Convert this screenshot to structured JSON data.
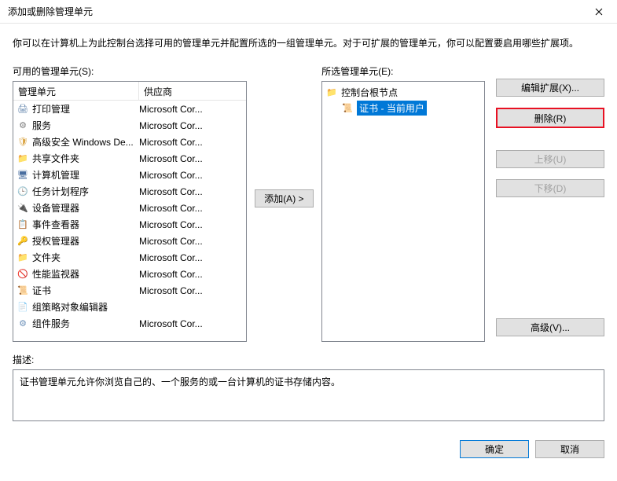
{
  "window": {
    "title": "添加或删除管理单元",
    "close_icon": "close-icon"
  },
  "intro": "你可以在计算机上为此控制台选择可用的管理单元并配置所选的一组管理单元。对于可扩展的管理单元，你可以配置要启用哪些扩展项。",
  "available": {
    "label": "可用的管理单元(S):",
    "columns": {
      "snapin": "管理单元",
      "vendor": "供应商"
    },
    "items": [
      {
        "icon": "printer-icon",
        "iconClass": "i-printer",
        "glyph": "🖨",
        "name": "打印管理",
        "vendor": "Microsoft Cor..."
      },
      {
        "icon": "gear-icon",
        "iconClass": "i-gear",
        "glyph": "⚙",
        "name": "服务",
        "vendor": "Microsoft Cor..."
      },
      {
        "icon": "shield-icon",
        "iconClass": "i-shield",
        "glyph": "🛡",
        "name": "高级安全 Windows De...",
        "vendor": "Microsoft Cor..."
      },
      {
        "icon": "share-icon",
        "iconClass": "i-share",
        "glyph": "📁",
        "name": "共享文件夹",
        "vendor": "Microsoft Cor..."
      },
      {
        "icon": "computer-icon",
        "iconClass": "i-comp",
        "glyph": "🖥",
        "name": "计算机管理",
        "vendor": "Microsoft Cor..."
      },
      {
        "icon": "clock-icon",
        "iconClass": "i-clock",
        "glyph": "🕒",
        "name": "任务计划程序",
        "vendor": "Microsoft Cor..."
      },
      {
        "icon": "device-icon",
        "iconClass": "i-dev",
        "glyph": "🔌",
        "name": "设备管理器",
        "vendor": "Microsoft Cor..."
      },
      {
        "icon": "event-icon",
        "iconClass": "i-event",
        "glyph": "📋",
        "name": "事件查看器",
        "vendor": "Microsoft Cor..."
      },
      {
        "icon": "auth-icon",
        "iconClass": "i-auth",
        "glyph": "🔑",
        "name": "授权管理器",
        "vendor": "Microsoft Cor..."
      },
      {
        "icon": "folder-icon",
        "iconClass": "i-folder",
        "glyph": "📁",
        "name": "文件夹",
        "vendor": "Microsoft Cor..."
      },
      {
        "icon": "perf-icon",
        "iconClass": "i-perf",
        "glyph": "🚫",
        "name": "性能监视器",
        "vendor": "Microsoft Cor..."
      },
      {
        "icon": "cert-icon",
        "iconClass": "i-cert",
        "glyph": "📜",
        "name": "证书",
        "vendor": "Microsoft Cor..."
      },
      {
        "icon": "gpo-icon",
        "iconClass": "i-gpo",
        "glyph": "📄",
        "name": "组策略对象编辑器",
        "vendor": ""
      },
      {
        "icon": "compsvc-icon",
        "iconClass": "i-compsvc",
        "glyph": "⚙",
        "name": "组件服务",
        "vendor": "Microsoft Cor..."
      }
    ]
  },
  "add_button": "添加(A) >",
  "selected": {
    "label": "所选管理单元(E):",
    "root": {
      "icon": "folder-icon",
      "glyph": "📁",
      "name": "控制台根节点"
    },
    "child": {
      "icon": "cert-icon",
      "glyph": "📜",
      "name": "证书 - 当前用户"
    }
  },
  "side": {
    "edit_ext": "编辑扩展(X)...",
    "remove": "删除(R)",
    "move_up": "上移(U)",
    "move_down": "下移(D)",
    "advanced": "高级(V)..."
  },
  "desc": {
    "label": "描述:",
    "text": "证书管理单元允许你浏览自己的、一个服务的或一台计算机的证书存储内容。"
  },
  "footer": {
    "ok": "确定",
    "cancel": "取消"
  }
}
